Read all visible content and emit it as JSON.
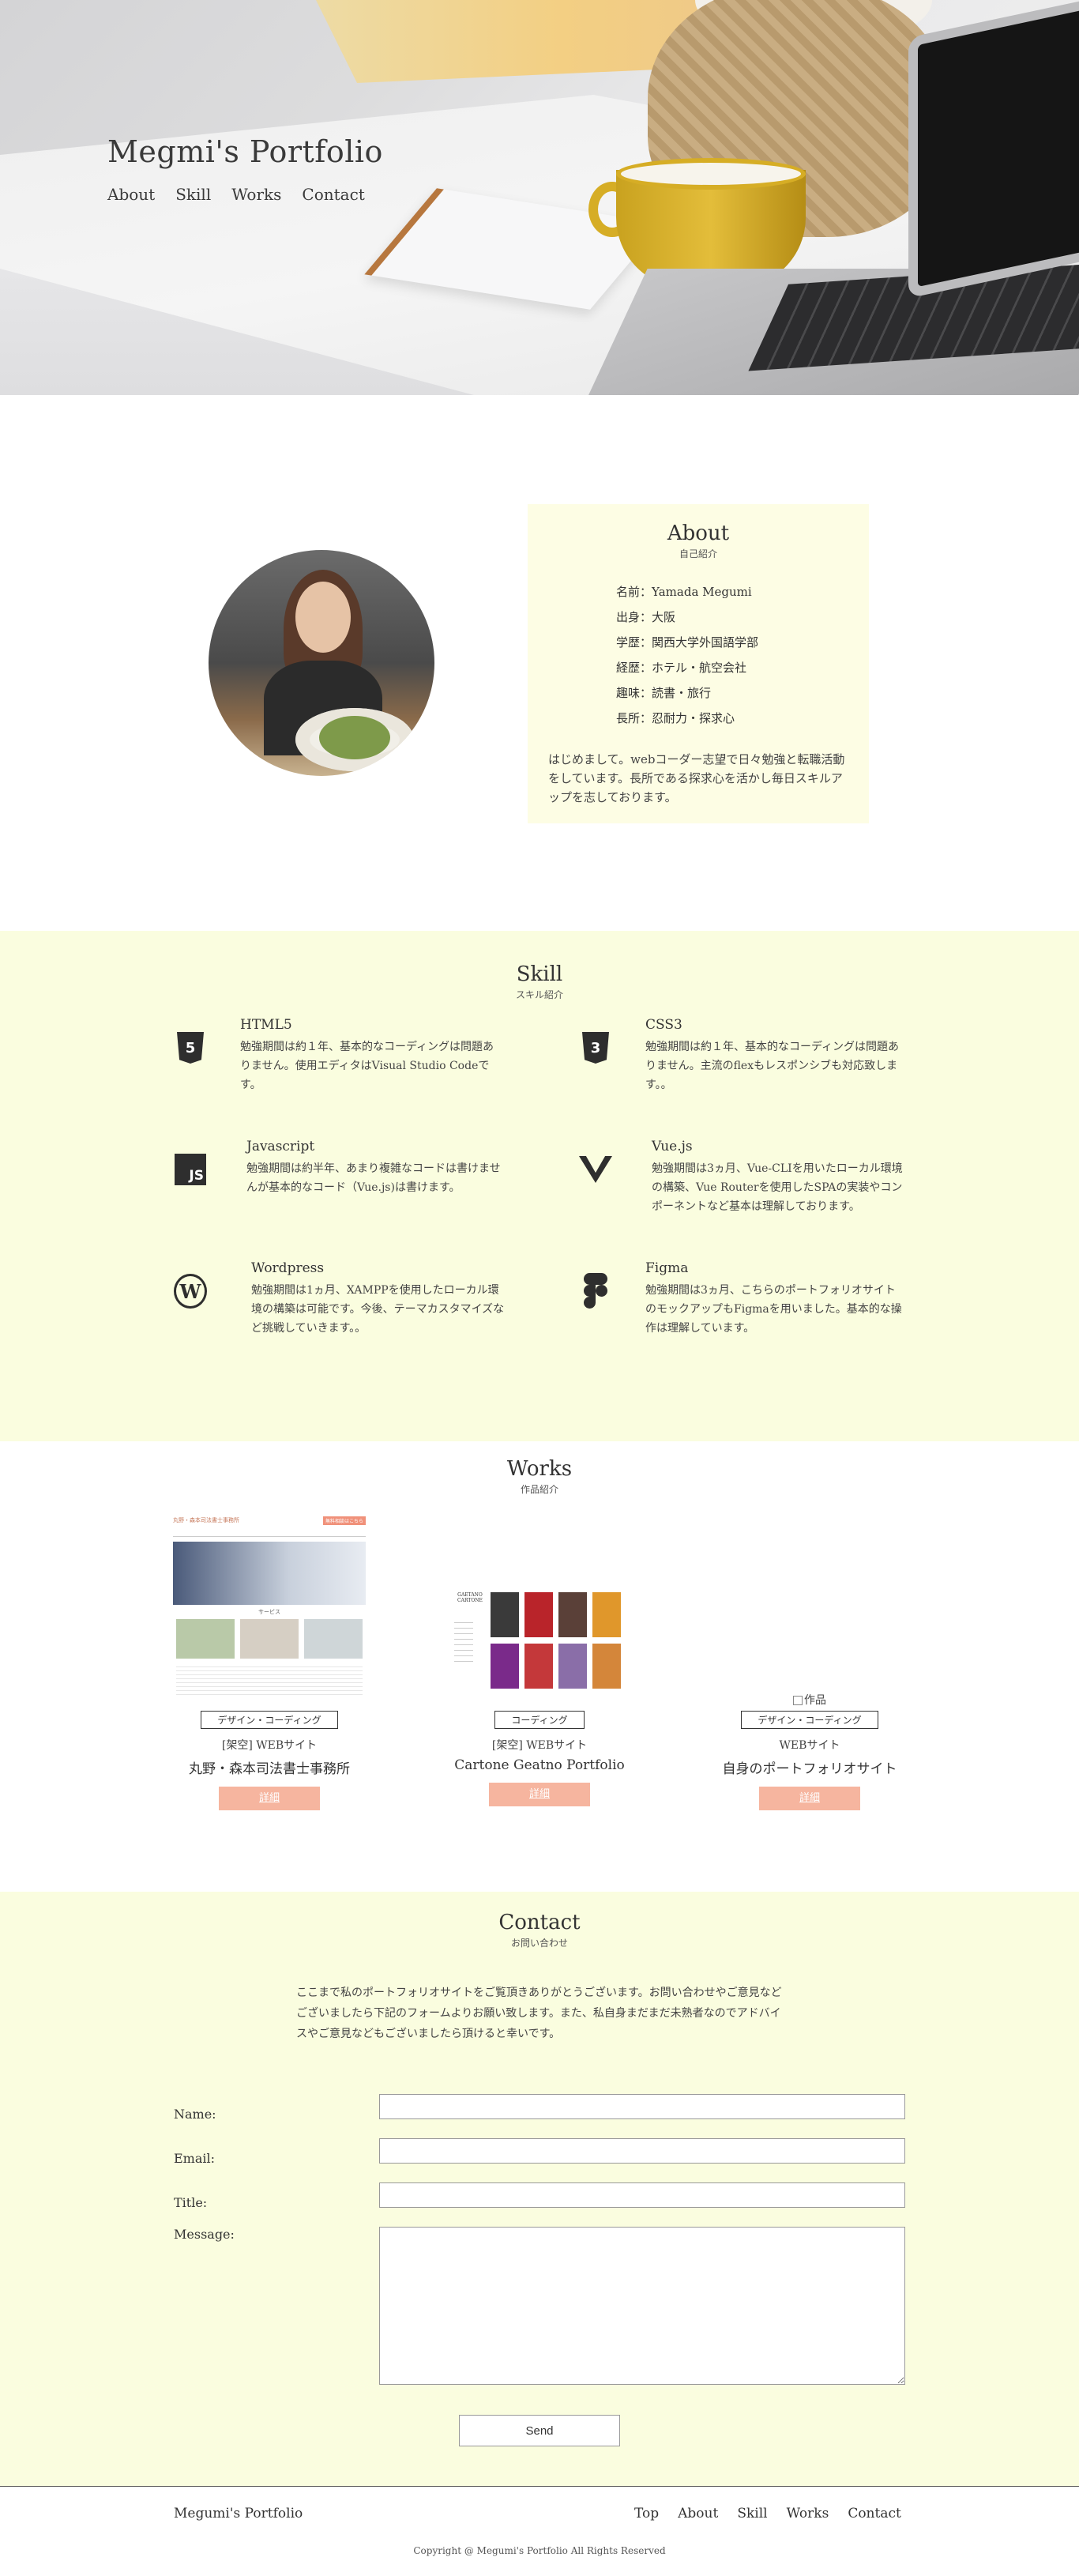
{
  "hero": {
    "title": "Megmi's Portfolio",
    "nav": [
      "About",
      "Skill",
      "Works",
      "Contact"
    ]
  },
  "about": {
    "title": "About",
    "subtitle": "自己紹介",
    "info": [
      "名前：Yamada Megumi",
      "出身：大阪",
      "学歴：関西大学外国語学部",
      "経歴：ホテル・航空会社",
      "趣味：読書・旅行",
      "長所：忍耐力・探求心"
    ],
    "intro": "はじめまして。webコーダー志望で日々勉強と転職活動をしています。長所である探求心を活かし毎日スキルアップを志しております。"
  },
  "skill": {
    "title": "Skill",
    "subtitle": "スキル紹介",
    "items": [
      {
        "name": "HTML5",
        "icon": "html5-icon",
        "desc": "勉強期間は約１年、基本的なコーディングは問題ありません。使用エディタはVisual Studio Codeです。"
      },
      {
        "name": "CSS3",
        "icon": "css3-icon",
        "desc": "勉強期間は約１年、基本的なコーディングは問題ありません。主流のflexもレスポンシブも対応致します。。"
      },
      {
        "name": "Javascript",
        "icon": "javascript-icon",
        "desc": "勉強期間は約半年、あまり複雑なコードは書けませんが基本的なコード（Vue.js)は書けます。"
      },
      {
        "name": "Vue.js",
        "icon": "vuejs-icon",
        "desc": "勉強期間は3ヵ月、Vue-CLIを用いたローカル環境の構築、Vue Routerを使用したSPAの実装やコンポーネントなど基本は理解しております。"
      },
      {
        "name": "Wordpress",
        "icon": "wordpress-icon",
        "desc": "勉強期間は1ヵ月、XAMPPを使用したローカル環境の構築は可能です。今後、テーマカスタマイズなど挑戦していきます。。"
      },
      {
        "name": "Figma",
        "icon": "figma-icon",
        "desc": "勉強期間は3ヵ月、こちらのポートフォリオサイトのモックアップもFigmaを用いました。基本的な操作は理解しています。"
      }
    ]
  },
  "works": {
    "title": "Works",
    "subtitle": "作品紹介",
    "items": [
      {
        "tag": "デザイン・コーディング",
        "kind": "[架空] WEBサイト",
        "name": "丸野・森本司法書士事務所",
        "button": "詳細",
        "thumb_header": "丸野・森本司法書士事務所",
        "thumb_cta": "無料相談はこちら",
        "thumb_section": "サービス"
      },
      {
        "tag": "コーディング",
        "kind": "[架空] WEBサイト",
        "name": "Cartone Geatno Portfolio",
        "button": "詳細",
        "thumb_brand": "GAETANO CARTONE"
      },
      {
        "tag": "デザイン・コーディング",
        "kind": "WEBサイト",
        "name": "自身のポートフォリオサイト",
        "button": "詳細",
        "img_alt": "作品"
      }
    ]
  },
  "contact": {
    "title": "Contact",
    "subtitle": "お問い合わせ",
    "lead": "ここまで私のポートフォリオサイトをご覧頂きありがとうございます。お問い合わせやご意見などございましたら下記のフォームよりお願い致します。また、私自身まだまだ未熟者なのでアドバイスやご意見などもございましたら頂けると幸いです。",
    "fields": {
      "name": "Name:",
      "email": "Email:",
      "title": "Title:",
      "message": "Message:"
    },
    "send": "Send"
  },
  "footer": {
    "brand": "Megumi's Portfolio",
    "nav": [
      "Top",
      "About",
      "Skill",
      "Works",
      "Contact"
    ],
    "copyright": "Copyright @ Megumi's Portfolio All Rights Reserved"
  }
}
